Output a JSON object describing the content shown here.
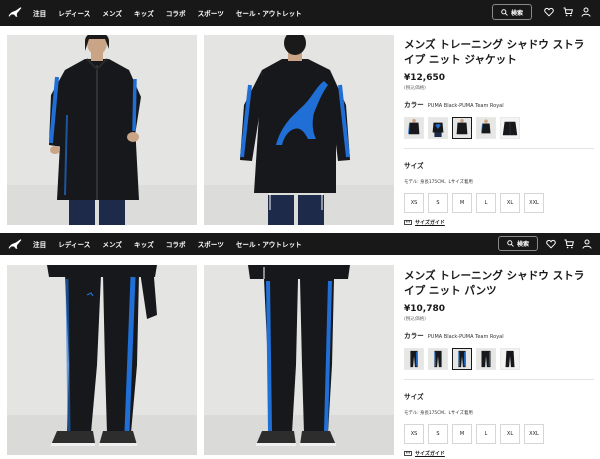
{
  "nav": {
    "items": [
      "注目",
      "レディース",
      "メンズ",
      "キッズ",
      "コラボ",
      "スポーツ",
      "セール・アウトレット"
    ],
    "search_label": "検索",
    "icons": [
      "puma-logo",
      "search-icon",
      "heart-icon",
      "cart-icon",
      "user-icon"
    ]
  },
  "products": [
    {
      "title": "メンズ トレーニング シャドウ ストライプ ニット ジャケット",
      "price": "¥12,650",
      "tax_note": "(税込価格)",
      "color_label": "カラー",
      "color_value": "PUMA Black-PUMA Team Royal",
      "size_label": "サイズ",
      "model_note": "モデル: 身長175CM、Lサイズ着用",
      "sizes": [
        "XS",
        "S",
        "M",
        "L",
        "XL",
        "XXL"
      ],
      "size_guide": "サイズガイド",
      "selected_swatch": 2
    },
    {
      "title": "メンズ トレーニング シャドウ ストライプ ニット パンツ",
      "price": "¥10,780",
      "tax_note": "(税込価格)",
      "color_label": "カラー",
      "color_value": "PUMA Black-PUMA Team Royal",
      "size_label": "サイズ",
      "model_note": "モデル: 身長175CM、Lサイズ着用",
      "sizes": [
        "XS",
        "S",
        "M",
        "L",
        "XL",
        "XXL"
      ],
      "size_guide": "サイズガイド",
      "selected_swatch": 2
    }
  ],
  "colors": {
    "header_bg": "#181818",
    "accent_blue": "#1f6fd6",
    "garment_black": "#17181b",
    "photo_bg": "#e3e3e1"
  }
}
